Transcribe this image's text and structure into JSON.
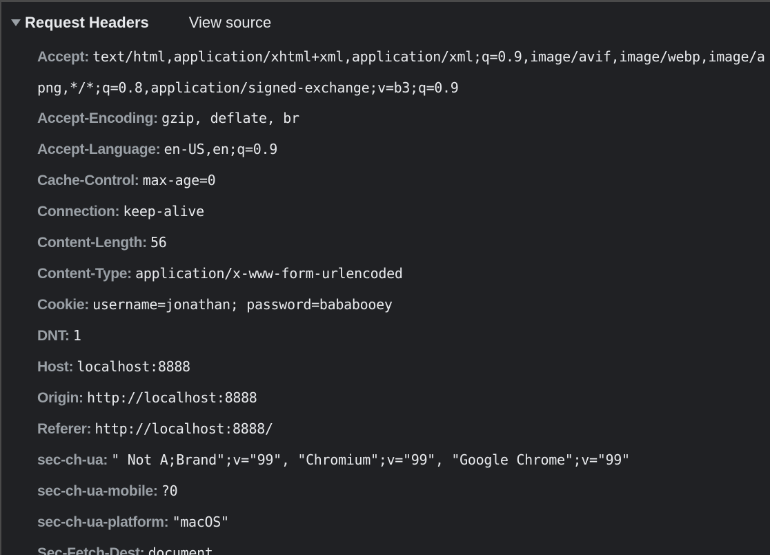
{
  "section": {
    "title": "Request Headers",
    "view_source_label": "View source"
  },
  "headers": [
    {
      "name": "Accept:",
      "value": "text/html,application/xhtml+xml,application/xml;q=0.9,image/avif,image/webp,image/apng,*/*;q=0.8,application/signed-exchange;v=b3;q=0.9"
    },
    {
      "name": "Accept-Encoding:",
      "value": "gzip, deflate, br"
    },
    {
      "name": "Accept-Language:",
      "value": "en-US,en;q=0.9"
    },
    {
      "name": "Cache-Control:",
      "value": "max-age=0"
    },
    {
      "name": "Connection:",
      "value": "keep-alive"
    },
    {
      "name": "Content-Length:",
      "value": "56"
    },
    {
      "name": "Content-Type:",
      "value": "application/x-www-form-urlencoded"
    },
    {
      "name": "Cookie:",
      "value": "username=jonathan; password=bababooey"
    },
    {
      "name": "DNT:",
      "value": "1"
    },
    {
      "name": "Host:",
      "value": "localhost:8888"
    },
    {
      "name": "Origin:",
      "value": "http://localhost:8888"
    },
    {
      "name": "Referer:",
      "value": "http://localhost:8888/"
    },
    {
      "name": "sec-ch-ua:",
      "value": "\" Not A;Brand\";v=\"99\", \"Chromium\";v=\"99\", \"Google Chrome\";v=\"99\""
    },
    {
      "name": "sec-ch-ua-mobile:",
      "value": "?0"
    },
    {
      "name": "sec-ch-ua-platform:",
      "value": "\"macOS\""
    },
    {
      "name": "Sec-Fetch-Dest:",
      "value": "document"
    }
  ],
  "icons": {
    "collapse": "triangle-down-icon"
  },
  "colors": {
    "background": "#202124",
    "header_name": "#9aa0a6",
    "header_value": "#e8eaed"
  }
}
